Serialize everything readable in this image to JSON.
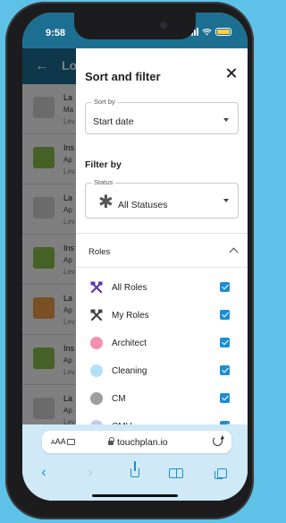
{
  "status_bar": {
    "time": "9:58"
  },
  "background_app": {
    "title_fragment": "Lo",
    "rows": [
      {
        "line1": "La",
        "line2": "Ma",
        "line3": "Lev",
        "check_color": "#d7d7d7"
      },
      {
        "line1": "Ins",
        "line2": "Ap",
        "line3": "Lev",
        "check_color": "#8bc34a"
      },
      {
        "line1": "La",
        "line2": "Ap",
        "line3": "Lev",
        "check_color": "#d7d7d7"
      },
      {
        "line1": "Ins",
        "line2": "Ap",
        "line3": "Lev",
        "check_color": "#8bc34a"
      },
      {
        "line1": "La",
        "line2": "Ap",
        "line3": "Lev",
        "check_color": "#f5a04a"
      },
      {
        "line1": "Ins",
        "line2": "Ap",
        "line3": "Lev",
        "check_color": "#8bc34a"
      },
      {
        "line1": "La",
        "line2": "Ap",
        "line3": "Lev",
        "check_color": "#d7d7d7"
      }
    ]
  },
  "drawer": {
    "title": "Sort and filter",
    "sort_by": {
      "label": "Sort by",
      "value": "Start date"
    },
    "filter_heading": "Filter by",
    "status": {
      "label": "Status",
      "value": "All Statuses",
      "icon": "asterisk-icon"
    },
    "roles_heading": "Roles",
    "roles": [
      {
        "label": "All Roles",
        "icon": "tools-icon",
        "color": "#5e35b1",
        "checked": true
      },
      {
        "label": "My Roles",
        "icon": "tools-icon",
        "color": "#444444",
        "checked": true
      },
      {
        "label": "Architect",
        "icon": "dot-icon",
        "color": "#f48fb1",
        "checked": true
      },
      {
        "label": "Cleaning",
        "icon": "dot-icon",
        "color": "#b3e0f7",
        "checked": true
      },
      {
        "label": "CM",
        "icon": "dot-icon",
        "color": "#9e9e9e",
        "checked": true
      },
      {
        "label": "CMU",
        "icon": "dot-icon",
        "color": "#c5cae9",
        "checked": true
      }
    ]
  },
  "safari": {
    "text_size_label": "AA",
    "url": "touchplan.io"
  },
  "colors": {
    "header": "#1d6f92",
    "accent": "#1a8ed6",
    "background": "#5ec1e8"
  }
}
